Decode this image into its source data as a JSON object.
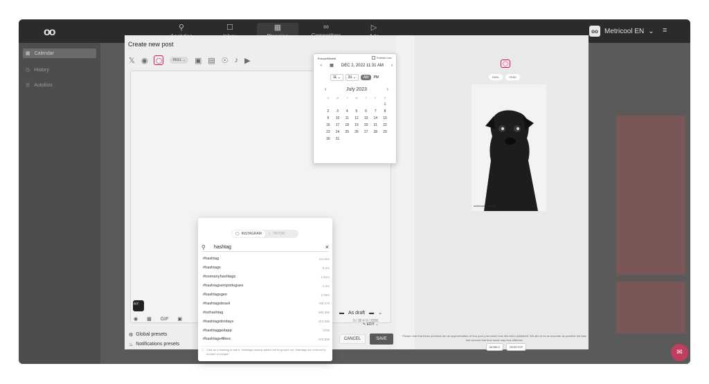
{
  "app": {
    "logo": "oo",
    "brand": "Metricool EN",
    "brand_initials": "oo",
    "brand_right_icon": "sliders-icon"
  },
  "nav": [
    {
      "label": "Analytics",
      "icon": "magnifier-icon"
    },
    {
      "label": "Inbox",
      "icon": "chat-bubbles-icon"
    },
    {
      "label": "Planning",
      "icon": "calendar-icon"
    },
    {
      "label": "Competitors",
      "icon": "link-icon"
    },
    {
      "label": "Ads",
      "icon": "megaphone-icon"
    }
  ],
  "sidebar": [
    {
      "label": "Calendar"
    },
    {
      "label": "History"
    },
    {
      "label": "Autolists"
    }
  ],
  "modal": {
    "title": "Create new post",
    "reel_label": "REEL",
    "alt_label": "ALT",
    "counter": "0 / 30 #   0 / 2200",
    "gif_label": "GIF",
    "presets": [
      "Global presets",
      "Notifications presets"
    ],
    "draft_label": "As draft",
    "edit_label": "EDIT",
    "cancel_label": "CANCEL",
    "save_label": "SAVE"
  },
  "preview": {
    "tabs": [
      "REEL",
      "FEED"
    ],
    "footer": "metricool · Follow",
    "devices": [
      "MOBILE",
      "DESKTOP"
    ],
    "note": "Please note that these previews are an approximation of how your post would look like when published. We aim to be as accurate as possible but take into account that final result may look different."
  },
  "datepicker": {
    "timezone": "Europe/Madrid",
    "publish_now": "Publish now",
    "date": "DEC 2, 2022 11:31 AM",
    "hour": "11",
    "minute": "31",
    "am": "AM",
    "pm": "PM",
    "month": "July 2023",
    "dow": [
      "S",
      "M",
      "T",
      "W",
      "T",
      "F",
      "S"
    ],
    "days": [
      "",
      "",
      "",
      "",
      "",
      "",
      "1",
      "2",
      "3",
      "4",
      "5",
      "6",
      "7",
      "8",
      "9",
      "10",
      "11",
      "12",
      "13",
      "14",
      "15",
      "16",
      "17",
      "18",
      "19",
      "20",
      "21",
      "22",
      "23",
      "24",
      "25",
      "26",
      "27",
      "28",
      "29",
      "30",
      "31"
    ]
  },
  "hashtags": {
    "tab_instagram": "INSTAGRAM",
    "tab_tiktok": "TIKTOK",
    "query": "hashtag",
    "results": [
      {
        "tag": "#hashtag",
        "count": "24.22m"
      },
      {
        "tag": "#hashtags",
        "count": "8.1m"
      },
      {
        "tag": "#toomanyhashtags",
        "count": "1.51m"
      },
      {
        "tag": "#hashtagsemportugues",
        "count": "1.2m"
      },
      {
        "tag": "#hashtagsgen",
        "count": "1.03m"
      },
      {
        "tag": "#hashtagsbrasil",
        "count": "758.27k"
      },
      {
        "tag": "#nohashtag",
        "count": "683.36k"
      },
      {
        "tag": "#hashtagsfordays",
        "count": "410.36k"
      },
      {
        "tag": "#hashtaggedapp",
        "count": "376k"
      },
      {
        "tag": "#hashtags4likes",
        "count": "372.56k"
      }
    ],
    "help": "Click on a hashtag to add it. Hashtags already added will be greyed out. Hashtags are ordered by number of usages"
  }
}
